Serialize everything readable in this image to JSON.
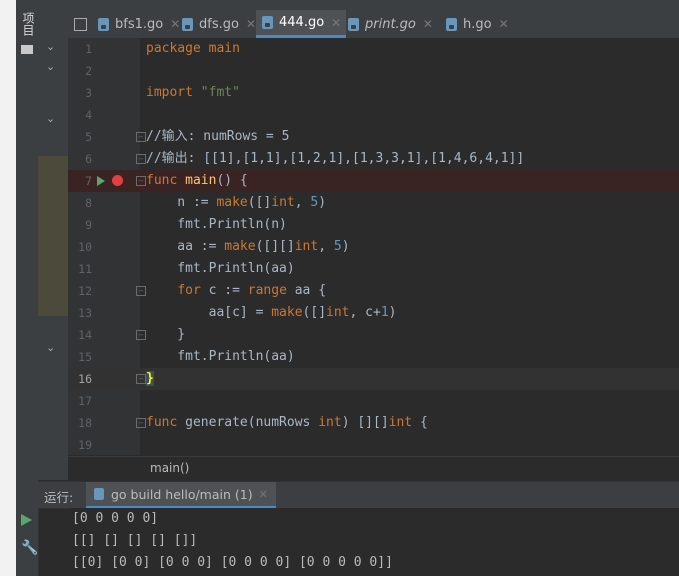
{
  "side_panel": {
    "project_label": "项目"
  },
  "tabs": [
    {
      "label": "bfs1.go",
      "active": false,
      "italic": false
    },
    {
      "label": "dfs.go",
      "active": false,
      "italic": false
    },
    {
      "label": "444.go",
      "active": true,
      "italic": false
    },
    {
      "label": "print.go",
      "active": false,
      "italic": true
    },
    {
      "label": "h.go",
      "active": false,
      "italic": false
    }
  ],
  "editor": {
    "line_numbers": [
      "1",
      "2",
      "3",
      "4",
      "5",
      "6",
      "7",
      "8",
      "9",
      "10",
      "11",
      "12",
      "13",
      "14",
      "15",
      "16",
      "17",
      "18",
      "19"
    ],
    "lines": [
      "package main",
      "",
      "import \"fmt\"",
      "",
      "//输入: numRows = 5",
      "//输出: [[1],[1,1],[1,2,1],[1,3,3,1],[1,4,6,4,1]]",
      "func main() {",
      "    n := make([]int, 5)",
      "    fmt.Println(n)",
      "    aa := make([][]int, 5)",
      "    fmt.Println(aa)",
      "    for c := range aa {",
      "        aa[c] = make([]int, c+1)",
      "    }",
      "    fmt.Println(aa)",
      "}",
      "",
      "func generate(numRows int) [][]int {",
      ""
    ],
    "breadcrumb": "main()"
  },
  "run_panel": {
    "label": "运行:",
    "tab_label": "go build hello/main (1)",
    "output": [
      "[0 0 0 0 0]",
      "[[] [] [] [] []]",
      "[[0] [0 0] [0 0 0] [0 0 0 0] [0 0 0 0 0]]"
    ]
  },
  "colors": {
    "keyword": "#cc7832",
    "string": "#6a8759",
    "comment": "#808080",
    "function": "#ffc66d",
    "number": "#6897bb",
    "breakpoint": "#e04040",
    "run": "#59a869"
  }
}
